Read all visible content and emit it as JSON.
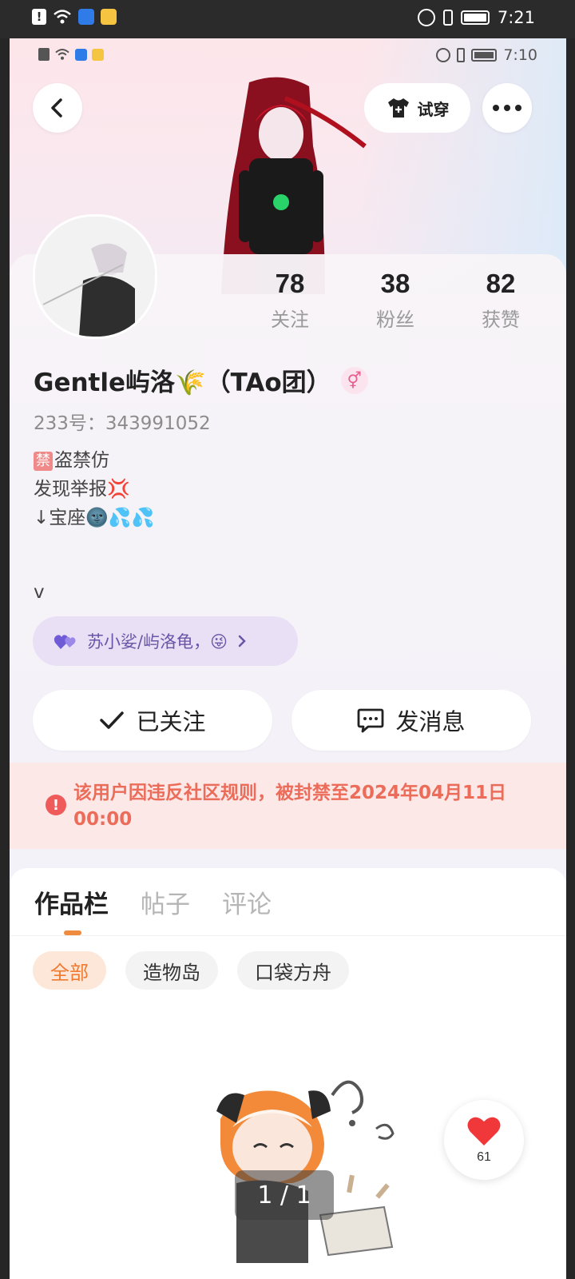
{
  "system_status": {
    "time": "7:21"
  },
  "inner_status": {
    "time": "7:10"
  },
  "header": {
    "try_on_label": "试穿"
  },
  "stats": [
    {
      "value": "78",
      "label": "关注"
    },
    {
      "value": "38",
      "label": "粉丝"
    },
    {
      "value": "82",
      "label": "获赞"
    }
  ],
  "profile": {
    "name": "Gentle屿洛🌾（TAo团）",
    "gender_symbol": "⚥",
    "uid": "233号：343991052",
    "bio": {
      "tag": "禁",
      "line1": "盗禁仿",
      "line2": "发现举报💢",
      "line3": "↓宝座🌚💦💦",
      "line4": "v"
    },
    "friend_pill": "苏小娑/屿洛龟，😜"
  },
  "actions": {
    "follow_label": "已关注",
    "message_label": "发消息"
  },
  "ban_notice": {
    "text": "该用户因违反社区规则，被封禁至2024年04月11日 00:00"
  },
  "works": {
    "tabs": [
      "作品栏",
      "帖子",
      "评论"
    ],
    "chips": [
      "全部",
      "造物岛",
      "口袋方舟"
    ],
    "page_indicator": "1 / 1",
    "like_count": "61"
  },
  "colors": {
    "accent_orange": "#ef7a30",
    "ban_red": "#ec6c5a",
    "friend_purple": "#6a55a8"
  }
}
